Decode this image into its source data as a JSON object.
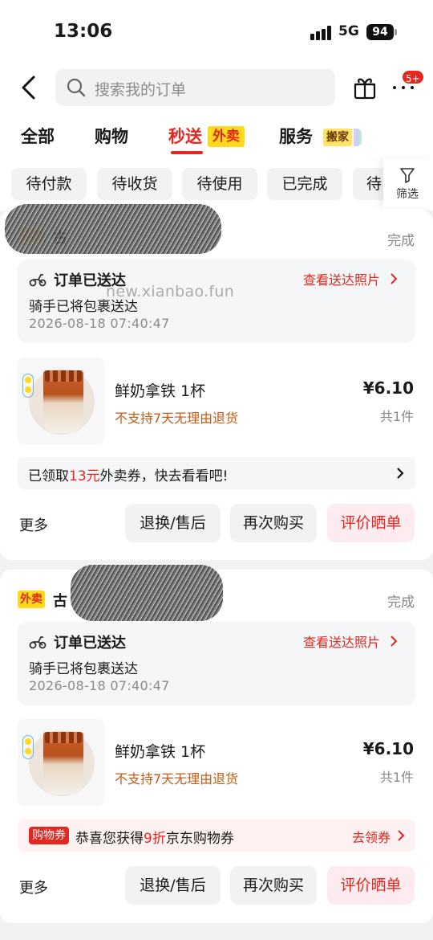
{
  "status_bar": {
    "time": "13:06",
    "network": "5G",
    "battery": "94"
  },
  "header": {
    "search_placeholder": "搜索我的订单",
    "more_badge": "5+"
  },
  "tabs": [
    {
      "label": "全部"
    },
    {
      "label": "购物"
    },
    {
      "label": "秒送",
      "tag": "外卖",
      "active": true
    },
    {
      "label": "服务",
      "tag": "搬家"
    }
  ],
  "filter_chips": [
    "待付款",
    "待收货",
    "待使用",
    "已完成",
    "待"
  ],
  "filter_label": "筛选",
  "orders": [
    {
      "shop_tag": "外卖",
      "shop_name": "古",
      "status": "完成",
      "delivery": {
        "title": "订单已送达",
        "photo_link": "查看送达照片",
        "subtitle": "骑手已将包裹送达",
        "time": "2026-08-18 07:40:47"
      },
      "product": {
        "name": "鲜奶拿铁 1杯",
        "note": "不支持7天无理由退货",
        "price": "¥6.10",
        "qty": "共1件"
      },
      "coupon": {
        "prefix": "已领取",
        "amount": "13元",
        "suffix": "外卖券，快去看看吧!"
      },
      "more": "更多",
      "buttons": {
        "refund": "退换/售后",
        "rebuy": "再次购买",
        "review": "评价晒单"
      }
    },
    {
      "shop_tag": "外卖",
      "shop_name": "古",
      "status": "完成",
      "delivery": {
        "title": "订单已送达",
        "photo_link": "查看送达照片",
        "subtitle": "骑手已将包裹送达",
        "time": "2026-08-18 07:40:47"
      },
      "product": {
        "name": "鲜奶拿铁 1杯",
        "note": "不支持7天无理由退货",
        "price": "¥6.10",
        "qty": "共1件"
      },
      "coupon": {
        "tag": "购物券",
        "prefix": "恭喜您获得",
        "amount": "9折",
        "suffix": "京东购物券",
        "action": "去领券"
      },
      "more": "更多",
      "buttons": {
        "refund": "退换/售后",
        "rebuy": "再次购买",
        "review": "评价晒单"
      }
    }
  ],
  "watermark": "new.xianbao.fun",
  "colors": {
    "accent": "#e4271f",
    "tag_yellow": "#ffd91a",
    "note_orange": "#c65a12"
  }
}
